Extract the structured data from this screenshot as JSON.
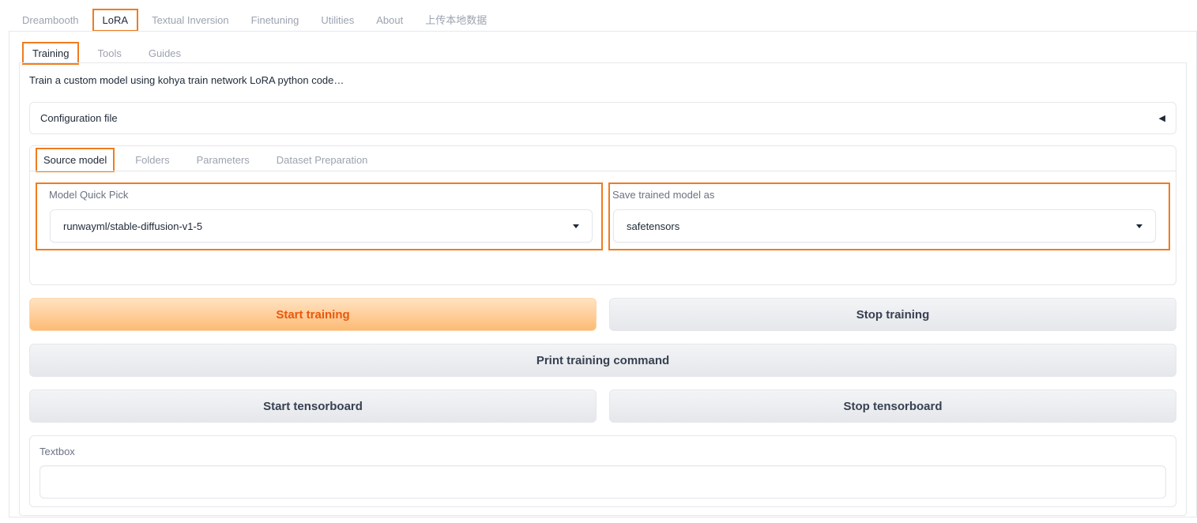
{
  "top_tabs": [
    "Dreambooth",
    "LoRA",
    "Textual Inversion",
    "Finetuning",
    "Utilities",
    "About",
    "上传本地数据"
  ],
  "top_tabs_active": "LoRA",
  "sub_tabs": [
    "Training",
    "Tools",
    "Guides"
  ],
  "sub_tabs_active": "Training",
  "description": "Train a custom model using kohya train network LoRA python code…",
  "config_accordion": {
    "label": "Configuration file",
    "arrow": "◀"
  },
  "model_tabs": [
    "Source model",
    "Folders",
    "Parameters",
    "Dataset Preparation"
  ],
  "model_tabs_active": "Source model",
  "model_quick_pick": {
    "label": "Model Quick Pick",
    "value": "runwayml/stable-diffusion-v1-5"
  },
  "save_as": {
    "label": "Save trained model as",
    "value": "safetensors"
  },
  "buttons": {
    "start_training": "Start training",
    "stop_training": "Stop training",
    "print_command": "Print training command",
    "start_tensorboard": "Start tensorboard",
    "stop_tensorboard": "Stop tensorboard"
  },
  "textbox": {
    "label": "Textbox",
    "value": ""
  },
  "colors": {
    "highlight": "#f07c1f",
    "primary_text": "#ea580c",
    "primary_bg": "#fdba74"
  }
}
